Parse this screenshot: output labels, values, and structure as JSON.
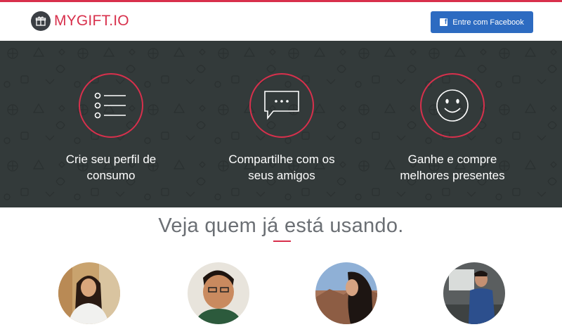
{
  "header": {
    "brand_main": "MYGIFT",
    "brand_tld": ".IO",
    "facebook_button": "Entre com Facebook",
    "accent_color": "#d8304c",
    "facebook_color": "#2d6bc1"
  },
  "features": [
    {
      "icon": "list-icon",
      "line1": "Crie seu perfil de",
      "line2": "consumo"
    },
    {
      "icon": "chat-bubble-icon",
      "line1": "Compartilhe com os",
      "line2": "seus amigos"
    },
    {
      "icon": "smiley-face-icon",
      "line1": "Ganhe e compre",
      "line2": "melhores presentes"
    }
  ],
  "users_section": {
    "title": "Veja quem já está usando.",
    "avatars": [
      "user-avatar-1",
      "user-avatar-2",
      "user-avatar-3",
      "user-avatar-4"
    ]
  }
}
